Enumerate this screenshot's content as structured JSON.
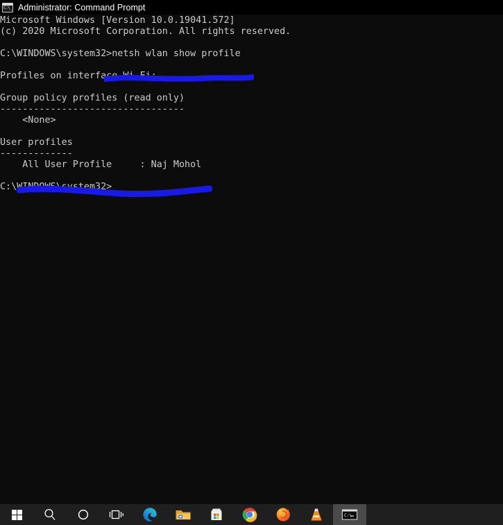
{
  "window": {
    "title": "Administrator: Command Prompt",
    "icon": "console-icon",
    "icon_glyph": "C:\\_"
  },
  "console": {
    "background_color": "#0c0c0c",
    "text_color": "#cccccc",
    "lines": [
      "Microsoft Windows [Version 10.0.19041.572]",
      "(c) 2020 Microsoft Corporation. All rights reserved.",
      "",
      "C:\\WINDOWS\\system32>netsh wlan show profile",
      "",
      "Profiles on interface Wi-Fi:",
      "",
      "Group policy profiles (read only)",
      "---------------------------------",
      "    <None>",
      "",
      "User profiles",
      "-------------",
      "    All User Profile     : Naj Mohol",
      "",
      "C:\\WINDOWS\\system32>"
    ],
    "command": "netsh wlan show profile",
    "prompt": "C:\\WINDOWS\\system32>",
    "interface": "Wi-Fi",
    "group_policy_profiles": "<None>",
    "user_profile_name": "Naj Mohol"
  },
  "annotations": {
    "color": "#1a1ae8",
    "items": [
      {
        "name": "command-underline",
        "target": "netsh wlan show profile"
      },
      {
        "name": "profile-underline",
        "target": "All User Profile     : Naj Mohol"
      }
    ]
  },
  "taskbar": {
    "background_color": "#1f1f1f",
    "items": [
      {
        "name": "start-button",
        "label": "Start"
      },
      {
        "name": "search-icon",
        "label": "Search"
      },
      {
        "name": "cortana-icon",
        "label": "Cortana"
      },
      {
        "name": "task-view-icon",
        "label": "Task View"
      },
      {
        "name": "microsoft-edge-icon",
        "label": "Microsoft Edge"
      },
      {
        "name": "file-explorer-icon",
        "label": "File Explorer"
      },
      {
        "name": "microsoft-store-icon",
        "label": "Microsoft Store"
      },
      {
        "name": "google-chrome-icon",
        "label": "Google Chrome"
      },
      {
        "name": "mozilla-firefox-icon",
        "label": "Mozilla Firefox"
      },
      {
        "name": "vlc-media-player-icon",
        "label": "VLC media player"
      },
      {
        "name": "command-prompt-icon",
        "label": "Command Prompt",
        "active": true
      }
    ]
  }
}
